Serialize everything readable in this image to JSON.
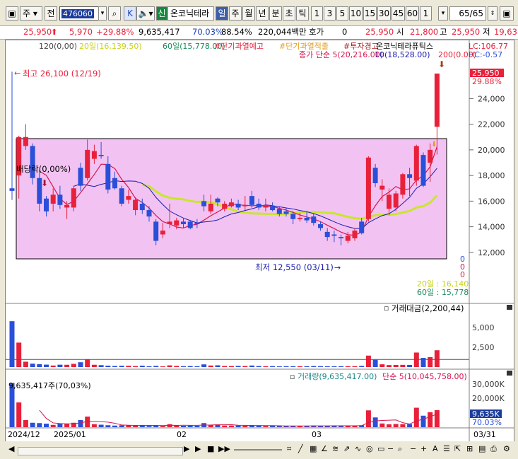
{
  "toolbar": {
    "market": "주",
    "prev_label": "전",
    "code": "476060",
    "k_label": "K",
    "shin_label": "신",
    "name": "온코닉테라",
    "periods": [
      "일",
      "주",
      "월",
      "년",
      "분",
      "초",
      "틱"
    ],
    "active_period": "일",
    "intervals": [
      "1",
      "3",
      "5",
      "10",
      "15",
      "30",
      "45",
      "60",
      "1"
    ],
    "count": "65/65"
  },
  "quote": {
    "price": "25,950",
    "change": "5,970",
    "rate": "+29.88%",
    "volume": "9,635,417",
    "ratio1": "70.03%",
    "ratio2": "88.54%",
    "amount": "220,044백만",
    "hoga_label": "호가",
    "hoga_value": "0",
    "open_price": "25,950",
    "high_label": "시",
    "high_value": "21,800",
    "go_label": "고",
    "go_value": "25,950",
    "low_label": "저",
    "low_value": "19,63"
  },
  "legend": {
    "ma120": "120(0,00)",
    "ma20": "20일(16,139.50)",
    "ma60": "60일(15,778.00)",
    "tag1": "#단기과열예고",
    "tag2": "#단기과열적출",
    "tag3": "#투자경고",
    "stock_name": "온코닉테라퓨틱스",
    "lc": "LC:106.77",
    "hc": "HC:-0.57",
    "close_ma5": "종가 단순 5(20,216.00)",
    "ma10": "10(18,528.00)",
    "ma200": "200(0.00)"
  },
  "annotations": {
    "high": "최고 26,100 (12/19)",
    "low": "최저 12,550 (03/11)",
    "dividend": "배당락(0,00%)",
    "ma20_right": "20일 : 16,140",
    "ma60_right": "60일 : 15,778",
    "zero1": "0",
    "zero2": "0",
    "zero3": "0"
  },
  "price_axis": {
    "ticks": [
      "24,000",
      "22,000",
      "20,000",
      "18,000",
      "16,000",
      "14,000",
      "12,000"
    ],
    "current": "25,950",
    "current_rate": "29.88%"
  },
  "panel2": {
    "title": "거래대금(2,200,44)",
    "ticks": [
      "5,000",
      "2,500"
    ]
  },
  "panel3": {
    "legend_vol": "거래량(9,635,417.00)",
    "legend_ma": "단순 5(10,045,758.00)",
    "left_label": "9,635,417주(70,03%)",
    "ticks": [
      "30,000K",
      "20,000K",
      "10,000K"
    ],
    "current": "9,635K",
    "current_rate": "70.03%"
  },
  "date_axis": [
    "2024/12",
    "2025/01",
    "02",
    "03"
  ],
  "date_right": "03/31",
  "colors": {
    "up": "#e8203a",
    "down": "#2a4fd8",
    "ma5": "#d6154f",
    "ma10": "#1b1bb0",
    "ma20": "#c9e62a",
    "ma60": "#1a8a5a",
    "box": "#f2c3f2"
  },
  "chart_data": {
    "type": "candlestick",
    "dates_start": "2024/12",
    "candles": [
      {
        "o": 17000,
        "h": 26100,
        "l": 16100,
        "c": 16800,
        "up": false
      },
      {
        "o": 18000,
        "h": 21100,
        "l": 16200,
        "c": 21000,
        "up": true
      },
      {
        "o": 21000,
        "h": 22000,
        "l": 20000,
        "c": 20300,
        "up": true
      },
      {
        "o": 20300,
        "h": 20500,
        "l": 17300,
        "c": 17800,
        "up": false
      },
      {
        "o": 17800,
        "h": 18400,
        "l": 15200,
        "c": 15800,
        "up": false
      },
      {
        "o": 16200,
        "h": 16400,
        "l": 14800,
        "c": 15200,
        "up": false
      },
      {
        "o": 15800,
        "h": 17000,
        "l": 15200,
        "c": 16500,
        "up": true
      },
      {
        "o": 16500,
        "h": 17200,
        "l": 15400,
        "c": 15700,
        "up": false
      },
      {
        "o": 15700,
        "h": 16000,
        "l": 14600,
        "c": 15500,
        "up": true
      },
      {
        "o": 15500,
        "h": 17200,
        "l": 15200,
        "c": 17000,
        "up": true
      },
      {
        "o": 17200,
        "h": 19000,
        "l": 16800,
        "c": 18600,
        "up": false
      },
      {
        "o": 17800,
        "h": 20800,
        "l": 17600,
        "c": 20000,
        "up": true
      },
      {
        "o": 19900,
        "h": 20400,
        "l": 18900,
        "c": 19300,
        "up": true
      },
      {
        "o": 19600,
        "h": 20600,
        "l": 19300,
        "c": 19500,
        "up": false
      },
      {
        "o": 18900,
        "h": 19500,
        "l": 16600,
        "c": 16900,
        "up": false
      },
      {
        "o": 17800,
        "h": 18300,
        "l": 16900,
        "c": 17000,
        "up": false
      },
      {
        "o": 17000,
        "h": 17200,
        "l": 15600,
        "c": 15800,
        "up": false
      },
      {
        "o": 16400,
        "h": 16900,
        "l": 15800,
        "c": 16100,
        "up": true
      },
      {
        "o": 16100,
        "h": 16300,
        "l": 14900,
        "c": 15300,
        "up": true
      },
      {
        "o": 15800,
        "h": 16200,
        "l": 15000,
        "c": 15300,
        "up": false
      },
      {
        "o": 15300,
        "h": 15600,
        "l": 14400,
        "c": 14800,
        "up": false
      },
      {
        "o": 14400,
        "h": 14600,
        "l": 12550,
        "c": 12900,
        "up": false
      },
      {
        "o": 13400,
        "h": 14300,
        "l": 13100,
        "c": 13700,
        "up": true
      },
      {
        "o": 14200,
        "h": 15800,
        "l": 13900,
        "c": 14400,
        "up": true
      },
      {
        "o": 14500,
        "h": 14700,
        "l": 13800,
        "c": 14100,
        "up": true
      },
      {
        "o": 14200,
        "h": 14700,
        "l": 13900,
        "c": 14400,
        "up": false
      },
      {
        "o": 14400,
        "h": 14500,
        "l": 13800,
        "c": 13900,
        "up": false
      },
      {
        "o": 14300,
        "h": 14600,
        "l": 13900,
        "c": 14200,
        "up": false
      },
      {
        "o": 15600,
        "h": 16500,
        "l": 15200,
        "c": 16000,
        "up": false
      },
      {
        "o": 15200,
        "h": 16500,
        "l": 15000,
        "c": 15800,
        "up": true
      },
      {
        "o": 16200,
        "h": 16300,
        "l": 15600,
        "c": 15900,
        "up": false
      },
      {
        "o": 15800,
        "h": 16000,
        "l": 15200,
        "c": 15400,
        "up": true
      },
      {
        "o": 15600,
        "h": 16200,
        "l": 15500,
        "c": 15900,
        "up": true
      },
      {
        "o": 15800,
        "h": 16100,
        "l": 15300,
        "c": 15500,
        "up": false
      },
      {
        "o": 15600,
        "h": 16400,
        "l": 15300,
        "c": 15700,
        "up": true
      },
      {
        "o": 16400,
        "h": 16800,
        "l": 15500,
        "c": 15700,
        "up": false
      },
      {
        "o": 15800,
        "h": 16200,
        "l": 15300,
        "c": 15500,
        "up": false
      },
      {
        "o": 15500,
        "h": 16200,
        "l": 15200,
        "c": 15700,
        "up": true
      },
      {
        "o": 15600,
        "h": 15900,
        "l": 15200,
        "c": 15300,
        "up": false
      },
      {
        "o": 15400,
        "h": 15600,
        "l": 14800,
        "c": 15000,
        "up": false
      },
      {
        "o": 15200,
        "h": 15500,
        "l": 14800,
        "c": 15000,
        "up": false
      },
      {
        "o": 15000,
        "h": 15200,
        "l": 14200,
        "c": 14600,
        "up": false
      },
      {
        "o": 14600,
        "h": 15100,
        "l": 14400,
        "c": 14700,
        "up": true
      },
      {
        "o": 14700,
        "h": 15200,
        "l": 14300,
        "c": 14500,
        "up": false
      },
      {
        "o": 14800,
        "h": 15000,
        "l": 14100,
        "c": 14300,
        "up": false
      },
      {
        "o": 14200,
        "h": 14400,
        "l": 13700,
        "c": 13900,
        "up": false
      },
      {
        "o": 13600,
        "h": 13900,
        "l": 12900,
        "c": 13200,
        "up": false
      },
      {
        "o": 13300,
        "h": 13700,
        "l": 12800,
        "c": 13400,
        "up": false
      },
      {
        "o": 13200,
        "h": 13400,
        "l": 12550,
        "c": 13100,
        "up": false
      },
      {
        "o": 12900,
        "h": 13600,
        "l": 12700,
        "c": 13300,
        "up": true
      },
      {
        "o": 13100,
        "h": 13900,
        "l": 12900,
        "c": 13700,
        "up": true
      },
      {
        "o": 13500,
        "h": 14700,
        "l": 13400,
        "c": 14400,
        "up": false
      },
      {
        "o": 14600,
        "h": 19500,
        "l": 14400,
        "c": 19400,
        "up": true
      },
      {
        "o": 18600,
        "h": 18900,
        "l": 17100,
        "c": 17400,
        "up": false
      },
      {
        "o": 17200,
        "h": 17700,
        "l": 16000,
        "c": 16900,
        "up": true
      },
      {
        "o": 16500,
        "h": 17000,
        "l": 14900,
        "c": 15400,
        "up": true
      },
      {
        "o": 15500,
        "h": 16800,
        "l": 15200,
        "c": 16600,
        "up": true
      },
      {
        "o": 16500,
        "h": 18200,
        "l": 16200,
        "c": 18100,
        "up": true
      },
      {
        "o": 18100,
        "h": 18600,
        "l": 16400,
        "c": 17800,
        "up": false
      },
      {
        "o": 17600,
        "h": 20400,
        "l": 17200,
        "c": 20300,
        "up": true
      },
      {
        "o": 19600,
        "h": 19800,
        "l": 17100,
        "c": 17200,
        "up": false
      },
      {
        "o": 19000,
        "h": 20500,
        "l": 17500,
        "c": 20000,
        "up": true
      },
      {
        "o": 21800,
        "h": 25950,
        "l": 19630,
        "c": 25950,
        "up": true
      }
    ],
    "trading_value": [
      6000,
      3200,
      700,
      450,
      380,
      320,
      200,
      310,
      300,
      420,
      630,
      1000,
      300,
      250,
      180,
      140,
      170,
      170,
      130,
      180,
      100,
      150,
      90,
      220,
      150,
      110,
      130,
      110,
      350,
      200,
      230,
      140,
      140,
      150,
      140,
      200,
      130,
      110,
      120,
      90,
      110,
      110,
      110,
      110,
      130,
      110,
      100,
      100,
      110,
      110,
      110,
      150,
      1500,
      950,
      360,
      260,
      280,
      290,
      280,
      1900,
      1200,
      1300,
      2200
    ],
    "volume": [
      25000,
      14000,
      4000,
      2500,
      2300,
      2000,
      1300,
      2100,
      1900,
      2500,
      4000,
      6000,
      1700,
      1400,
      1100,
      900,
      1100,
      1100,
      850,
      1200,
      700,
      1100,
      700,
      1700,
      1100,
      800,
      950,
      800,
      2300,
      1300,
      1500,
      900,
      900,
      950,
      900,
      1200,
      800,
      700,
      800,
      600,
      700,
      700,
      700,
      700,
      900,
      800,
      750,
      750,
      800,
      800,
      800,
      1100,
      9500,
      5500,
      2100,
      1600,
      1800,
      1700,
      1700,
      11000,
      6500,
      8500,
      9635
    ],
    "ylim": [
      11000,
      27000
    ]
  }
}
